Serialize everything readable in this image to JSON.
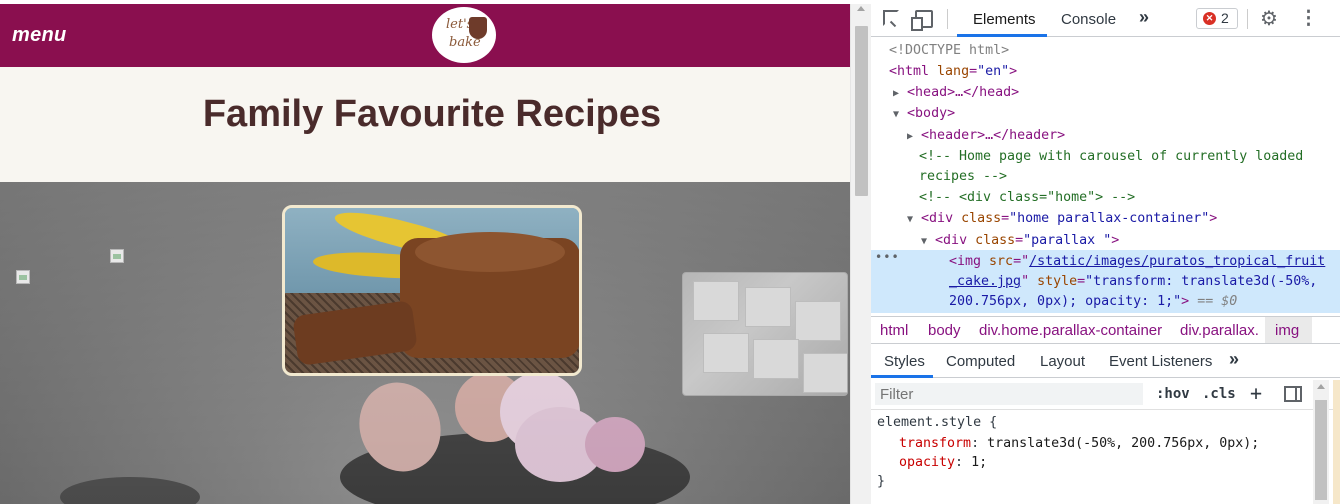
{
  "site": {
    "menu_label": "menu",
    "logo_alt": "let's bake",
    "page_title": "Family Favourite Recipes",
    "brand_color": "#8a0f4f"
  },
  "devtools": {
    "tabs": {
      "elements": "Elements",
      "console": "Console",
      "more": "»"
    },
    "error_count": "2",
    "dom": {
      "doctype": "<!DOCTYPE html>",
      "html_open": "<html",
      "html_lang_attr": "lang",
      "html_lang_val": "\"en\"",
      "head": "<head>…</head>",
      "body_open": "<body>",
      "header": "<header>…</header>",
      "comment1_a": "<!-- Home page with carousel of currently loaded",
      "comment1_b": "recipes -->",
      "comment2": "<!-- <div class=\"home\"> -->",
      "div1_tag": "<div",
      "div1_attr": "class",
      "div1_val": "\"home parallax-container\"",
      "div2_tag": "<div",
      "div2_attr": "class",
      "div2_val": "\"parallax \"",
      "img_tag": "<img",
      "img_src_attr": "src",
      "img_src_a": "/static/images/puratos_tropical_fruit",
      "img_src_b": "_cake.jpg",
      "img_style_attr": "style",
      "img_style_a": "\"transform: translate3d(-50%,",
      "img_style_b": "200.756px, 0px); opacity: 1;\"",
      "img_eq": "== $0"
    },
    "breadcrumb": [
      "html",
      "body",
      "div.home.parallax-container",
      "div.parallax.",
      "img"
    ],
    "styles_tabs": [
      "Styles",
      "Computed",
      "Layout",
      "Event Listeners",
      "»"
    ],
    "filter_placeholder": "Filter",
    "filter_buttons": {
      "hov": ":hov",
      "cls": ".cls",
      "plus": "+"
    },
    "element_style": {
      "selector": "element.style {",
      "prop1_name": "transform",
      "prop1_value": "translate3d(-50%, 200.756px, 0px);",
      "prop2_name": "opacity",
      "prop2_value": "1;",
      "close": "}"
    }
  }
}
